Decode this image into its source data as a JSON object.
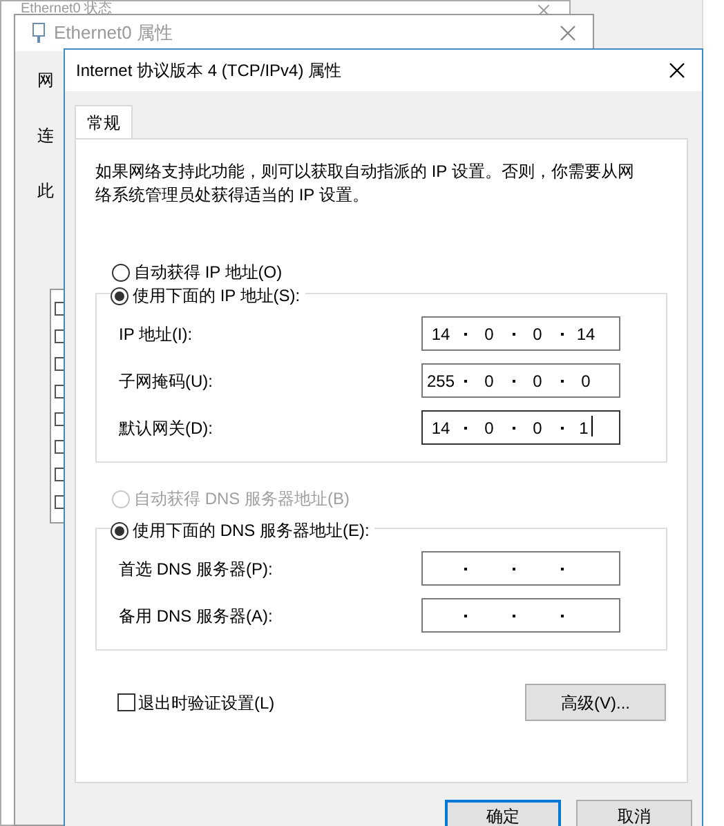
{
  "back_windows": [
    {
      "title": "Ethernet0 状态"
    },
    {
      "title": "Ethernet0 属性",
      "fragments": [
        "网",
        "连",
        "此"
      ]
    }
  ],
  "dialog": {
    "title": "Internet 协议版本 4 (TCP/IPv4) 属性",
    "tabs": [
      {
        "label": "常规",
        "selected": true
      }
    ],
    "intro": "如果网络支持此功能，则可以获取自动指派的 IP 设置。否则，你需要从网络系统管理员处获得适当的 IP 设置。",
    "ip_mode": [
      {
        "label": "自动获得 IP 地址(O)",
        "selected": false,
        "disabled": false
      },
      {
        "label": "使用下面的 IP 地址(S):",
        "selected": true,
        "disabled": false
      }
    ],
    "ip_fields": [
      {
        "label": "IP 地址(I):",
        "octets": [
          "14",
          "0",
          "0",
          "14"
        ],
        "focused": false
      },
      {
        "label": "子网掩码(U):",
        "octets": [
          "255",
          "0",
          "0",
          "0"
        ],
        "focused": false
      },
      {
        "label": "默认网关(D):",
        "octets": [
          "14",
          "0",
          "0",
          "1"
        ],
        "focused": true
      }
    ],
    "dns_mode": [
      {
        "label": "自动获得 DNS 服务器地址(B)",
        "selected": false,
        "disabled": true
      },
      {
        "label": "使用下面的 DNS 服务器地址(E):",
        "selected": true,
        "disabled": false
      }
    ],
    "dns_fields": [
      {
        "label": "首选 DNS 服务器(P):",
        "focused": false
      },
      {
        "label": "备用 DNS 服务器(A):",
        "focused": false
      }
    ],
    "validate": {
      "label": "退出时验证设置(L)",
      "checked": false
    },
    "advanced_button": "高级(V)...",
    "buttons": [
      {
        "label": "确定",
        "default": true
      },
      {
        "label": "取消",
        "default": false
      }
    ]
  }
}
